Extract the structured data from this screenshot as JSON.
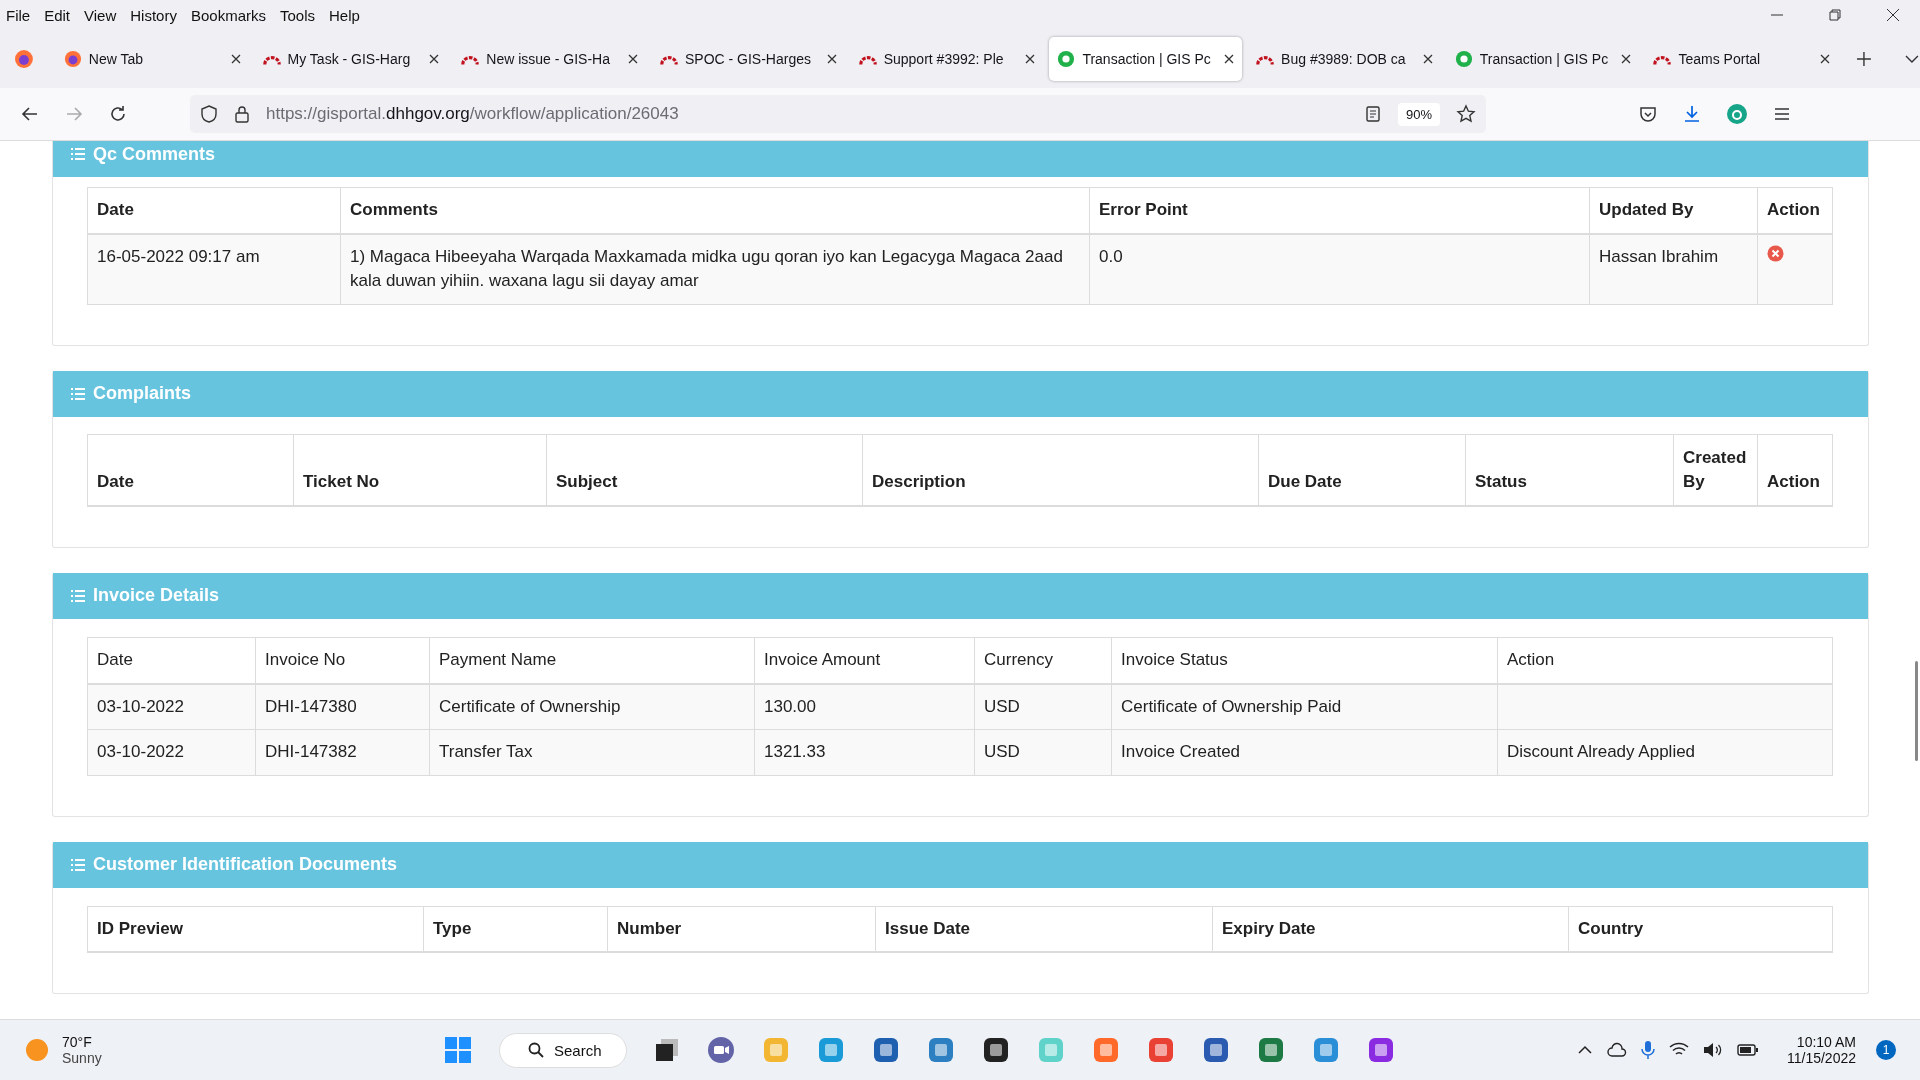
{
  "menu": [
    "File",
    "Edit",
    "View",
    "History",
    "Bookmarks",
    "Tools",
    "Help"
  ],
  "tabs": [
    {
      "title": "New Tab",
      "kind": "browser",
      "selected": false
    },
    {
      "title": "My Task - GIS-Harg",
      "kind": "tracker",
      "selected": false
    },
    {
      "title": "New issue - GIS-Ha",
      "kind": "tracker",
      "selected": false
    },
    {
      "title": "SPOC - GIS-Harges",
      "kind": "tracker",
      "selected": false
    },
    {
      "title": "Support #3992: Ple",
      "kind": "tracker",
      "selected": false
    },
    {
      "title": "Transaction | GIS Pc",
      "kind": "portal",
      "selected": true
    },
    {
      "title": "Bug #3989: DOB ca",
      "kind": "tracker",
      "selected": false
    },
    {
      "title": "Transaction | GIS Pc",
      "kind": "portal",
      "selected": false
    },
    {
      "title": "Teams Portal",
      "kind": "tracker",
      "selected": false
    }
  ],
  "address": {
    "prefix": "https://gisportal.",
    "domain": "dhhgov.org",
    "path": "/workflow/application/26043",
    "zoom": "90%"
  },
  "sections": [
    {
      "title": "Qc Comments",
      "columns": [
        "Date",
        "Comments",
        "Error Point",
        "Updated By",
        "Action"
      ],
      "rows": [
        {
          "cells": [
            "16-05-2022 09:17 am",
            "1) Magaca Hibeeyaha Warqada Maxkamada midka ugu qoran iyo kan Legacyga Magaca 2aad kala duwan yihiin. waxana lagu sii dayay amar",
            "0.0",
            "Hassan Ibrahim",
            null
          ],
          "remove": true
        }
      ]
    },
    {
      "title": "Complaints",
      "columns": [
        "Date",
        "Ticket No",
        "Subject",
        "Description",
        "Due Date",
        "Status",
        "Created By",
        "Action"
      ]
    },
    {
      "title": "Invoice Details",
      "columns": [
        "Date",
        "Invoice No",
        "Payment Name",
        "Invoice Amount",
        "Currency",
        "Invoice Status",
        "Action"
      ],
      "rows": [
        {
          "cells": [
            "03-10-2022",
            "DHI-147380",
            "Certificate of Ownership",
            "130.00",
            "USD",
            "Certificate of Ownership Paid",
            null
          ]
        },
        {
          "cells": [
            "03-10-2022",
            "DHI-147382",
            "Transfer Tax",
            "1321.33",
            "USD",
            "Invoice Created",
            "Discount Already Applied"
          ]
        }
      ]
    },
    {
      "title": "Customer Identification Documents",
      "columns": [
        "ID Preview",
        "Type",
        "Number",
        "Issue Date",
        "Expiry Date",
        "Country"
      ]
    }
  ],
  "taskbar": {
    "temperature": "70°F",
    "weather": "Sunny",
    "search": "Search",
    "time": "10:10 AM",
    "date": "11/15/2022",
    "notifications": "1"
  }
}
